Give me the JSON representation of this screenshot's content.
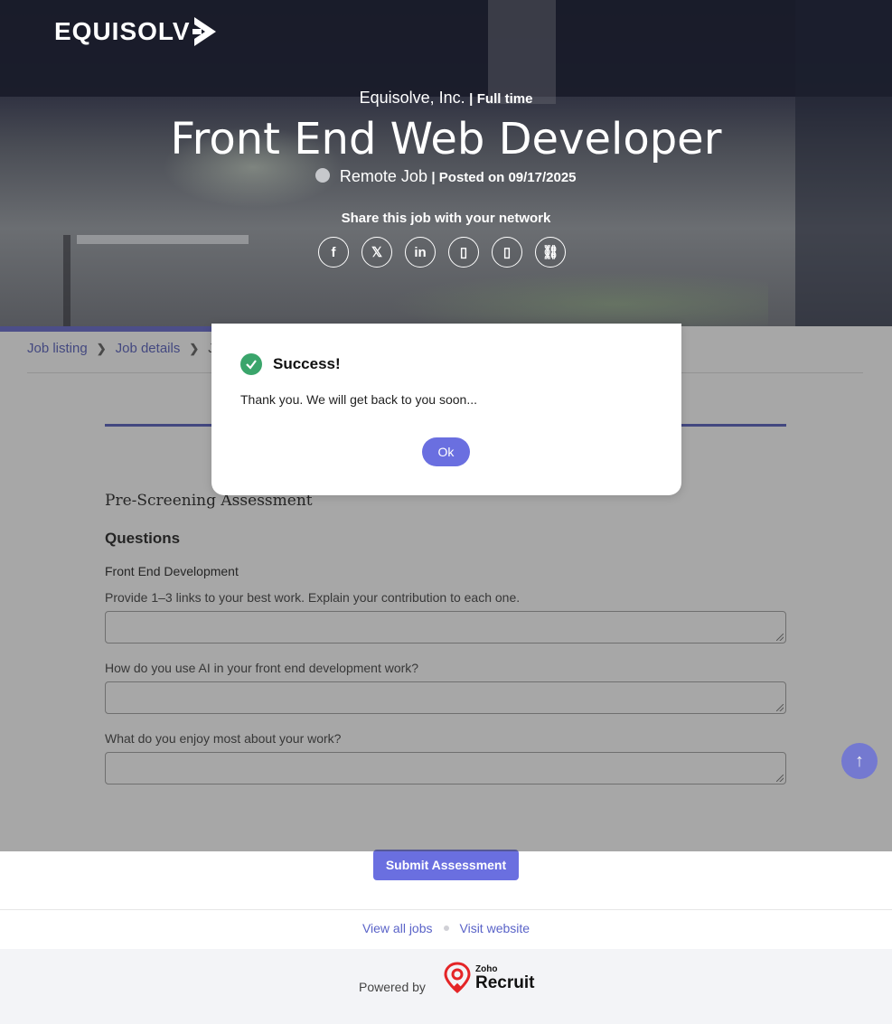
{
  "header": {
    "logo_text": "EQUISOLV",
    "company": "Equisolve, Inc.",
    "separator": "|",
    "job_type": "Full time",
    "job_title": "Front End Web Developer",
    "location": "Remote Job",
    "posted": "| Posted on 09/17/2025",
    "share_label": "Share this job with your network",
    "share_buttons": [
      {
        "icon": "facebook-icon",
        "glyph": "f"
      },
      {
        "icon": "x-icon",
        "glyph": "𝕏"
      },
      {
        "icon": "linkedin-icon",
        "glyph": "in"
      },
      {
        "icon": "share-icon-1",
        "glyph": "▯"
      },
      {
        "icon": "share-icon-2",
        "glyph": "▯"
      },
      {
        "icon": "link-icon",
        "glyph": "⛓"
      }
    ]
  },
  "breadcrumb": {
    "items": [
      "Job listing",
      "Job details",
      "Jo"
    ]
  },
  "form": {
    "section_title": "Pre-Screening Assessment",
    "questions_heading": "Questions",
    "subsection": "Front End Development",
    "questions": [
      {
        "label": "Provide 1–3 links to your best work. Explain your contribution to each one.",
        "value": ""
      },
      {
        "label": "How do you use AI in your front end development work?",
        "value": ""
      },
      {
        "label": "What do you enjoy most about your work?",
        "value": ""
      }
    ],
    "submit_label": "Submit Assessment"
  },
  "footer": {
    "view_all_jobs": "View all jobs",
    "visit_website": "Visit website",
    "powered_by": "Powered by",
    "brand_small": "Zoho",
    "brand_big": "Recruit"
  },
  "modal": {
    "title": "Success!",
    "message": "Thank you. We will get back to you soon...",
    "ok_label": "Ok"
  },
  "colors": {
    "accent": "#6a6fe0",
    "link": "#4a53b8",
    "success": "#3aa56b"
  }
}
